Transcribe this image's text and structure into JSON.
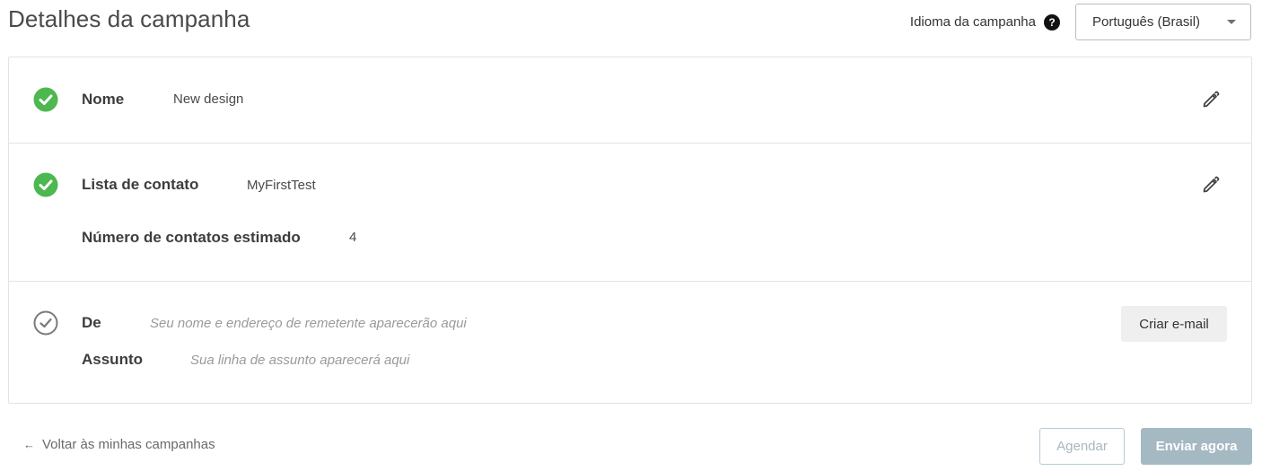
{
  "header": {
    "title": "Detalhes da campanha",
    "language_label": "Idioma da campanha",
    "help_icon": "question-circle-icon",
    "language_value": "Português (Brasil)"
  },
  "sections": {
    "name": {
      "status_icon": "check-circle-filled-icon",
      "label": "Nome",
      "value": "New design",
      "edit_icon": "pencil-icon"
    },
    "contacts": {
      "status_icon": "check-circle-filled-icon",
      "label": "Lista de contato",
      "value": "MyFirstTest",
      "estimate_label": "Número de contatos estimado",
      "estimate_value": "4",
      "edit_icon": "pencil-icon"
    },
    "email": {
      "status_icon": "check-circle-outline-icon",
      "from_label": "De",
      "from_placeholder": "Seu nome e endereço de remetente aparecerão aqui",
      "subject_label": "Assunto",
      "subject_placeholder": "Sua linha de assunto aparecerá aqui",
      "create_button": "Criar e-mail"
    }
  },
  "footer": {
    "back_arrow": "←",
    "back_label": "Voltar às minhas campanhas",
    "schedule_button": "Agendar",
    "send_button": "Enviar agora"
  },
  "colors": {
    "success": "#4cb84f",
    "pending": "#7a7a7a",
    "disabled_primary": "#a5b9c2"
  }
}
